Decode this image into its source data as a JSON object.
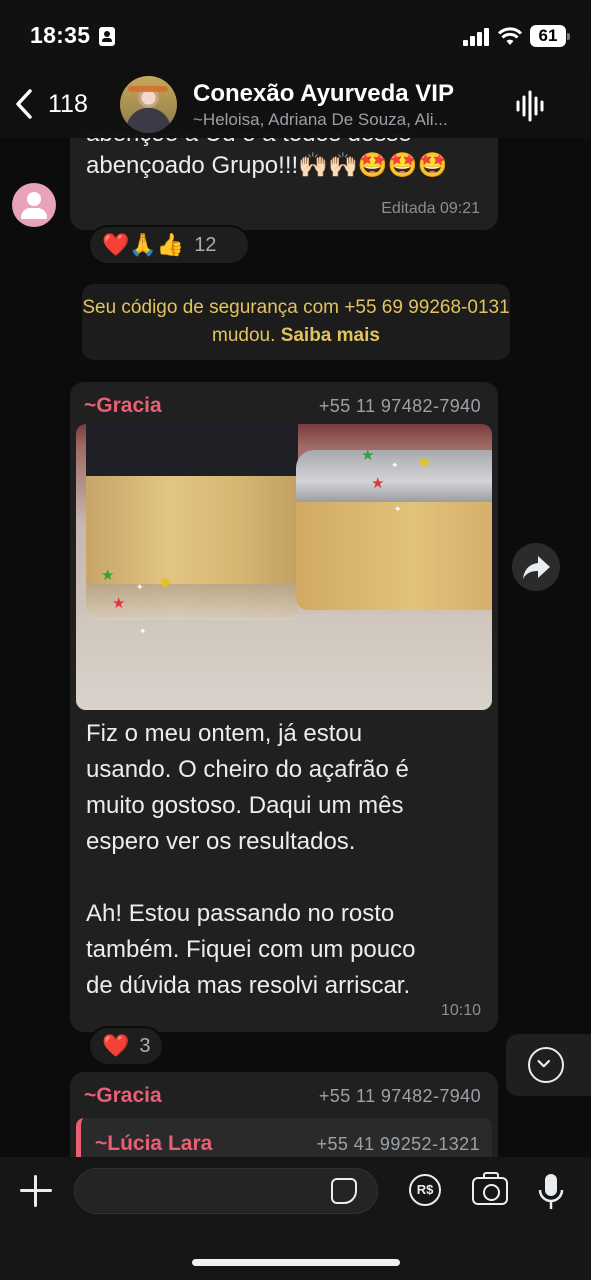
{
  "status_bar": {
    "time": "18:35",
    "battery": "61"
  },
  "header": {
    "back_count": "118",
    "group_name": "Conexão Ayurveda VIP",
    "members": "~Heloisa, Adriana De Souza, Ali..."
  },
  "messages": [
    {
      "text_cut": "abençõe a Ud e a todos desse",
      "text": "abençoado Grupo!!!🙌🏻🙌🏻🤩🤩🤩",
      "meta": "Editada 09:21",
      "reactions": {
        "emojis": "❤️🙏👍",
        "count": "12"
      }
    },
    {
      "system": "Seu código de segurança com +55 69 99268-0131 mudou.",
      "link": "Saiba mais"
    },
    {
      "sender": "~Gracia",
      "phone": "+55 11 97482-7940",
      "body_lines": [
        "Fiz o meu ontem, já estou",
        "usando. O cheiro do açafrão é",
        "muito gostoso. Daqui um mês",
        "espero ver os resultados.",
        "",
        "Ah! Estou passando no rosto",
        "também.  Fiquei com um pouco",
        "de dúvida  mas resolvi arriscar."
      ],
      "meta": "10:10",
      "reactions": {
        "emojis": "❤️",
        "count": "3"
      }
    },
    {
      "sender": "~Gracia",
      "phone": "+55 11 97482-7940",
      "quote": {
        "sender": "~Lúcia Lara",
        "phone": "+55 41 99252-1321"
      }
    }
  ],
  "input": {
    "pay_label": "R$"
  },
  "colors": {
    "sender": "#e95f74",
    "system": "#e2c35d",
    "bubble": "#202020",
    "background": "#0c0c0c"
  },
  "icons": [
    "back-chevron-icon",
    "voice-chat-icon",
    "forward-icon",
    "chevron-down-icon",
    "plus-icon",
    "sticker-icon",
    "pay-icon",
    "camera-icon",
    "mic-icon"
  ]
}
